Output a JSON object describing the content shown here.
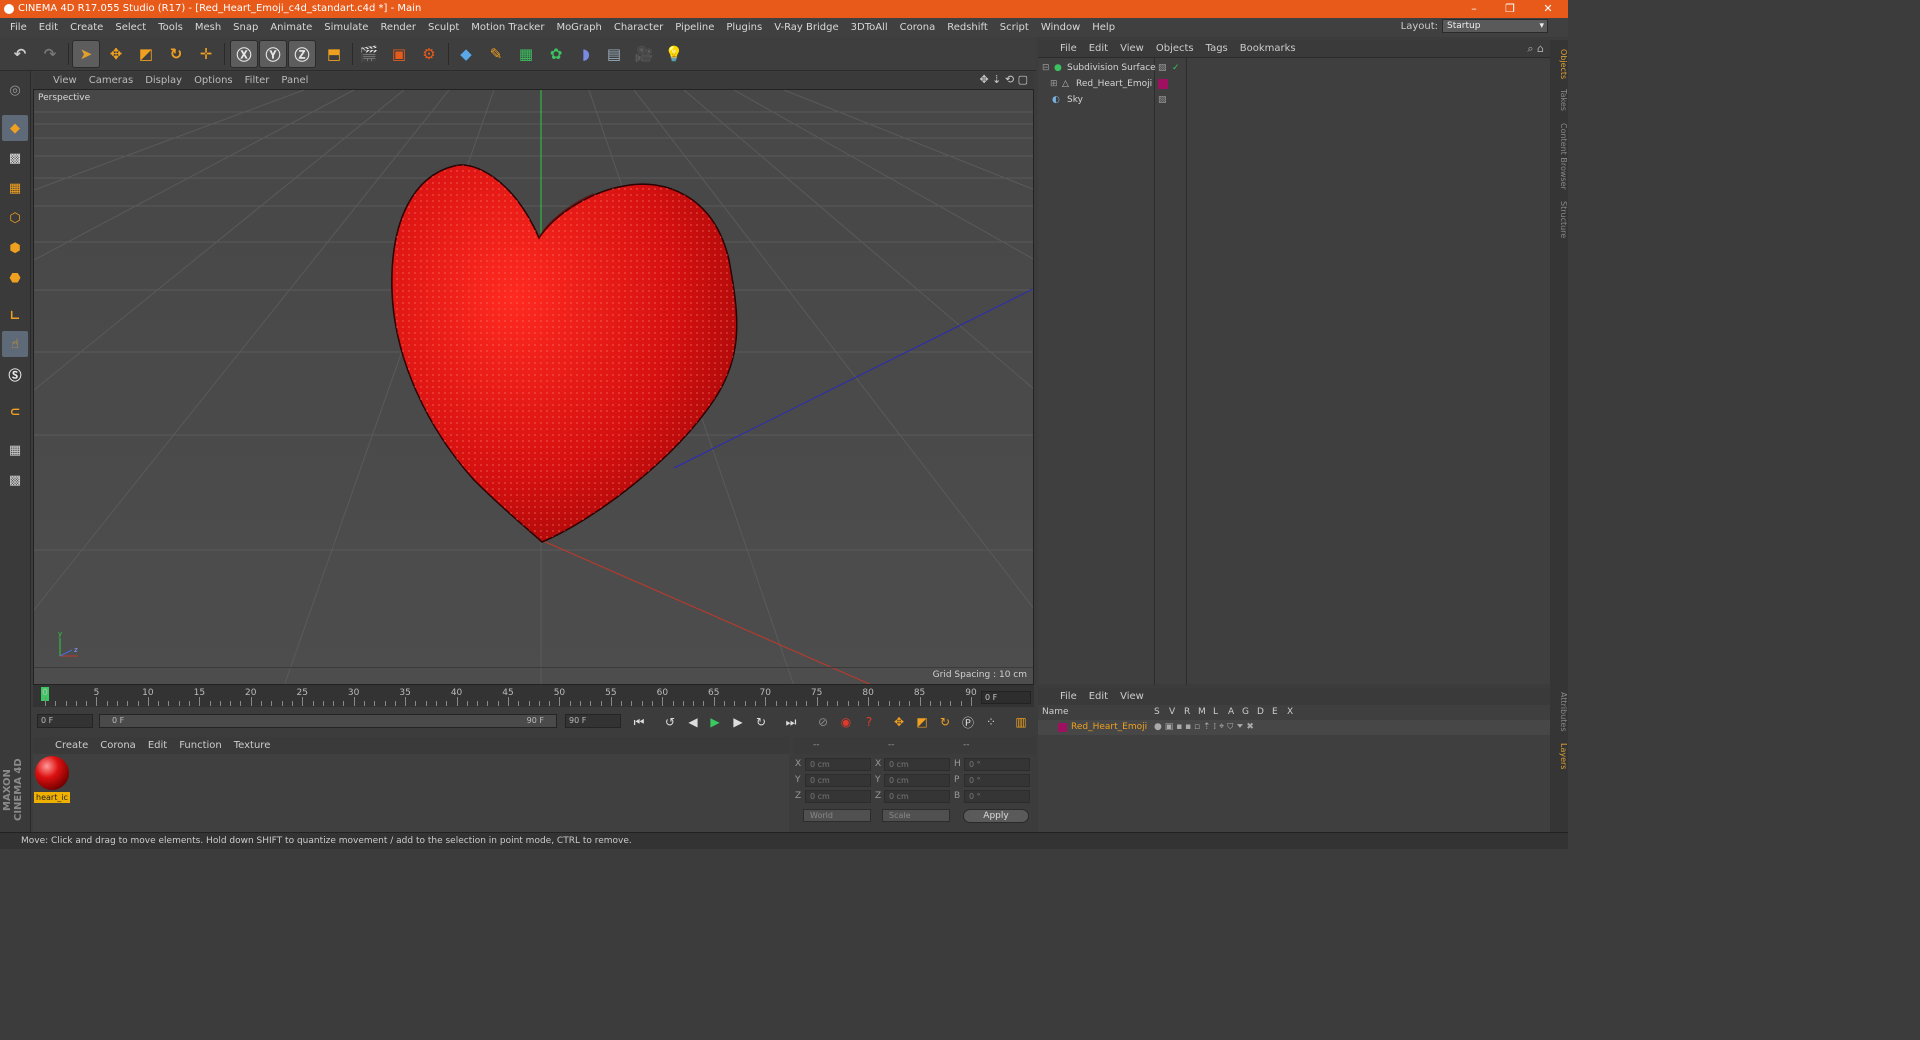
{
  "window": {
    "title": "CINEMA 4D R17.055 Studio (R17) - [Red_Heart_Emoji_c4d_standart.c4d *] - Main",
    "controls": [
      "–",
      "❐",
      "✕"
    ]
  },
  "menubar": {
    "items": [
      "File",
      "Edit",
      "Create",
      "Select",
      "Tools",
      "Mesh",
      "Snap",
      "Animate",
      "Simulate",
      "Render",
      "Sculpt",
      "Motion Tracker",
      "MoGraph",
      "Character",
      "Pipeline",
      "Plugins",
      "V-Ray Bridge",
      "3DToAll",
      "Corona",
      "Redshift",
      "Script",
      "Window",
      "Help"
    ],
    "layout_label": "Layout:",
    "layout_value": "Startup"
  },
  "viewport": {
    "menu": [
      "View",
      "Cameras",
      "Display",
      "Options",
      "Filter",
      "Panel"
    ],
    "label": "Perspective",
    "grid_spacing": "Grid Spacing : 10 cm",
    "axis_x_color": "#c0392b",
    "axis_y_color": "#2ecc40",
    "axis_z_color": "#2a2ab8",
    "heart_color": "#d41010"
  },
  "timeline": {
    "ticks": [
      "0",
      "5",
      "10",
      "15",
      "20",
      "25",
      "30",
      "35",
      "40",
      "45",
      "50",
      "55",
      "60",
      "65",
      "70",
      "75",
      "80",
      "85",
      "90"
    ],
    "current_frame": "0 F",
    "start_field": "0 F",
    "range_start": "0 F",
    "range_end": "90 F",
    "end_field": "90 F"
  },
  "material_manager": {
    "menu": [
      "Create",
      "Corona",
      "Edit",
      "Function",
      "Texture"
    ],
    "material_name": "heart_ic"
  },
  "coordinates": {
    "header": [
      "--",
      "--",
      "--"
    ],
    "rows": [
      {
        "axis": "X",
        "pos": "0 cm",
        "axis2": "X",
        "size": "0 cm",
        "axis3": "H",
        "rot": "0 °"
      },
      {
        "axis": "Y",
        "pos": "0 cm",
        "axis2": "Y",
        "size": "0 cm",
        "axis3": "P",
        "rot": "0 °"
      },
      {
        "axis": "Z",
        "pos": "0 cm",
        "axis2": "Z",
        "size": "0 cm",
        "axis3": "B",
        "rot": "0 °"
      }
    ],
    "mode_world": "World",
    "mode_scale": "Scale",
    "apply": "Apply"
  },
  "objects": {
    "menu": [
      "File",
      "Edit",
      "View",
      "Objects",
      "Tags",
      "Bookmarks"
    ],
    "items": [
      {
        "name": "Subdivision Surface"
      },
      {
        "name": "Red_Heart_Emoji"
      },
      {
        "name": "Sky"
      }
    ]
  },
  "side_tabs": [
    "Objects",
    "Takes",
    "Content Browser",
    "Structure"
  ],
  "side_tabs_lower": [
    "Attributes",
    "Layers"
  ],
  "layers": {
    "menu": [
      "File",
      "Edit",
      "View"
    ],
    "columns": [
      "Name",
      "S",
      "V",
      "R",
      "M",
      "L",
      "A",
      "G",
      "D",
      "E",
      "X"
    ],
    "row_name": "Red_Heart_Emoji"
  },
  "branding": "MAXON CINEMA 4D",
  "status": "Move: Click and drag to move elements. Hold down SHIFT to quantize movement / add to the selection in point mode, CTRL to remove."
}
